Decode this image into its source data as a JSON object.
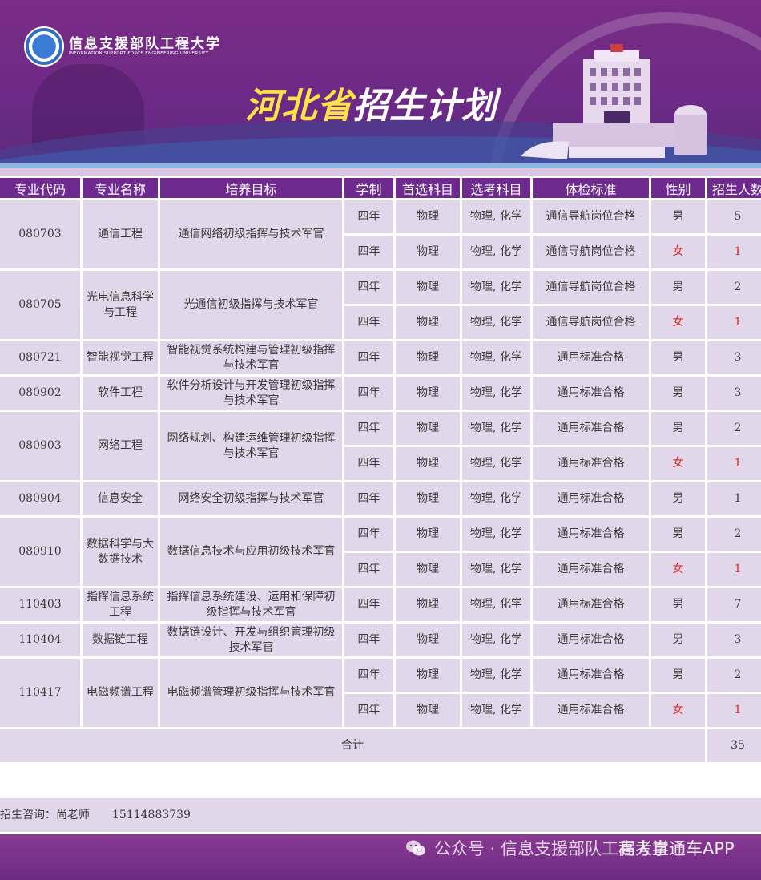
{
  "header": {
    "university_cn": "信息支援部队工程大学",
    "university_en": "INFORMATION SUPPORT FORCE ENGINEERING UNIVERSITY",
    "title_part1": "河北省",
    "title_part2": "招生计划"
  },
  "table": {
    "columns": [
      "专业代码",
      "专业名称",
      "培养目标",
      "学制",
      "首选科目",
      "选考科目",
      "体检标准",
      "性别",
      "招生人数"
    ],
    "rows": [
      {
        "code": "080703",
        "name": "通信工程",
        "goal": "通信网络初级指挥与技术军官",
        "duration": "四年",
        "first_subject": "物理",
        "elective_subjects": "物理, 化学",
        "physical_standard": "通信导航岗位合格",
        "gender": "男",
        "count": "5"
      },
      {
        "duration": "四年",
        "first_subject": "物理",
        "elective_subjects": "物理, 化学",
        "physical_standard": "通信导航岗位合格",
        "gender": "女",
        "count": "1"
      },
      {
        "code": "080705",
        "name": "光电信息科学与工程",
        "goal": "光通信初级指挥与技术军官",
        "duration": "四年",
        "first_subject": "物理",
        "elective_subjects": "物理, 化学",
        "physical_standard": "通信导航岗位合格",
        "gender": "男",
        "count": "2"
      },
      {
        "duration": "四年",
        "first_subject": "物理",
        "elective_subjects": "物理, 化学",
        "physical_standard": "通信导航岗位合格",
        "gender": "女",
        "count": "1"
      },
      {
        "code": "080721",
        "name": "智能视觉工程",
        "goal": "智能视觉系统构建与管理初级指挥与技术军官",
        "duration": "四年",
        "first_subject": "物理",
        "elective_subjects": "物理, 化学",
        "physical_standard": "通用标准合格",
        "gender": "男",
        "count": "3"
      },
      {
        "code": "080902",
        "name": "软件工程",
        "goal": "软件分析设计与开发管理初级指挥与技术军官",
        "duration": "四年",
        "first_subject": "物理",
        "elective_subjects": "物理, 化学",
        "physical_standard": "通用标准合格",
        "gender": "男",
        "count": "3"
      },
      {
        "code": "080903",
        "name": "网络工程",
        "goal": "网络规划、构建运维管理初级指挥与技术军官",
        "duration": "四年",
        "first_subject": "物理",
        "elective_subjects": "物理, 化学",
        "physical_standard": "通用标准合格",
        "gender": "男",
        "count": "2"
      },
      {
        "duration": "四年",
        "first_subject": "物理",
        "elective_subjects": "物理, 化学",
        "physical_standard": "通用标准合格",
        "gender": "女",
        "count": "1"
      },
      {
        "code": "080904",
        "name": "信息安全",
        "goal": "网络安全初级指挥与技术军官",
        "duration": "四年",
        "first_subject": "物理",
        "elective_subjects": "物理, 化学",
        "physical_standard": "通用标准合格",
        "gender": "男",
        "count": "1"
      },
      {
        "code": "080910",
        "name": "数据科学与大数据技术",
        "goal": "数据信息技术与应用初级技术军官",
        "duration": "四年",
        "first_subject": "物理",
        "elective_subjects": "物理, 化学",
        "physical_standard": "通用标准合格",
        "gender": "男",
        "count": "2"
      },
      {
        "duration": "四年",
        "first_subject": "物理",
        "elective_subjects": "物理, 化学",
        "physical_standard": "通用标准合格",
        "gender": "女",
        "count": "1"
      },
      {
        "code": "110403",
        "name": "指挥信息系统工程",
        "goal": "指挥信息系统建设、运用和保障初级指挥与技术军官",
        "duration": "四年",
        "first_subject": "物理",
        "elective_subjects": "物理, 化学",
        "physical_standard": "通用标准合格",
        "gender": "男",
        "count": "7"
      },
      {
        "code": "110404",
        "name": "数据链工程",
        "goal": "数据链设计、开发与组织管理初级技术军官",
        "duration": "四年",
        "first_subject": "物理",
        "elective_subjects": "物理, 化学",
        "physical_standard": "通用标准合格",
        "gender": "男",
        "count": "3"
      },
      {
        "code": "110417",
        "name": "电磁频谱工程",
        "goal": "电磁频谱管理初级指挥与技术军官",
        "duration": "四年",
        "first_subject": "物理",
        "elective_subjects": "物理, 化学",
        "physical_standard": "通用标准合格",
        "gender": "男",
        "count": "2"
      },
      {
        "duration": "四年",
        "first_subject": "物理",
        "elective_subjects": "物理, 化学",
        "physical_standard": "通用标准合格",
        "gender": "女",
        "count": "1"
      }
    ],
    "total_label": "合计",
    "total_value": "35"
  },
  "consult": {
    "label": "招生咨询：尚老师",
    "phone": "15114883739"
  },
  "watermark": {
    "wechat": "公众号 · 信息支援部队工程大学",
    "app": "高考直通车APP"
  },
  "colors": {
    "header_bg": "#6e2a8e",
    "cell_bg": "#e2d6ea",
    "title_yellow": "#ffe14a",
    "female_red": "#e02a2a"
  }
}
